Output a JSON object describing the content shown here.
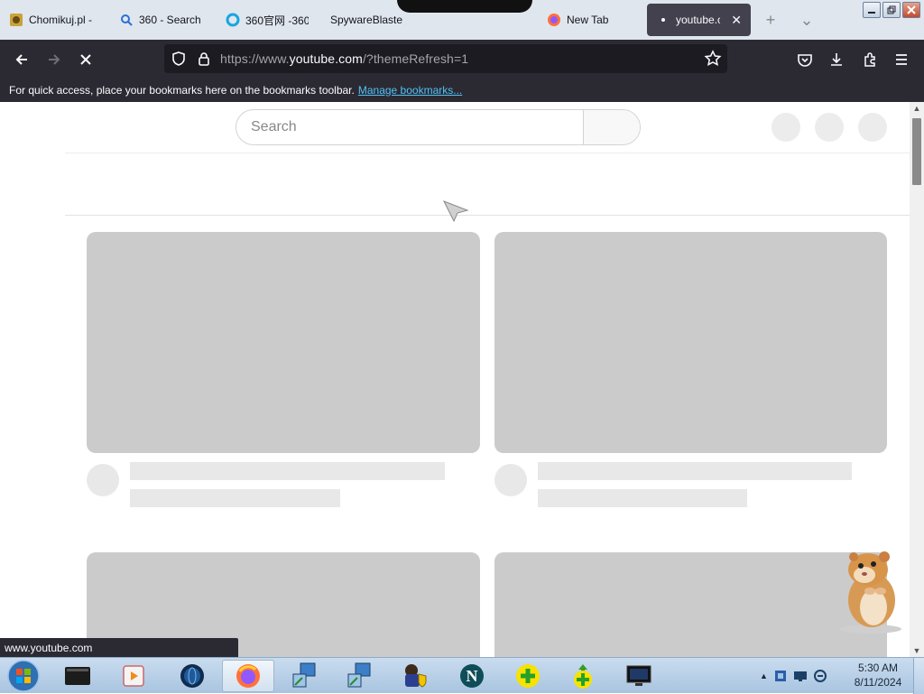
{
  "browser": {
    "tabs": [
      {
        "title": "Chomikuj.pl -",
        "icon": "chomikuj-icon"
      },
      {
        "title": "360 - Search",
        "icon": "search-icon"
      },
      {
        "title": "360官网 -360",
        "icon": "360-icon"
      },
      {
        "title": "SpywareBlaster",
        "icon": "generic-icon"
      },
      {
        "title": "",
        "icon": "generic-icon"
      },
      {
        "title": "New Tab",
        "icon": "firefox-icon"
      },
      {
        "title": "youtube.co",
        "icon": "loading-dot-icon",
        "active": true
      }
    ],
    "new_tab_label": "+",
    "list_tabs_label": "⌄",
    "url": {
      "prefix": "https://www.",
      "host": "youtube.com",
      "path": "/?themeRefresh=1"
    },
    "bookmarks_message": "For quick access, place your bookmarks here on the bookmarks toolbar.",
    "bookmarks_link": "Manage bookmarks...",
    "status_url": "www.youtube.com"
  },
  "youtube": {
    "search_placeholder": "Search"
  },
  "taskbar": {
    "apps": [
      {
        "name": "terminal-app-icon"
      },
      {
        "name": "media-player-icon"
      },
      {
        "name": "globe-app-icon"
      },
      {
        "name": "firefox-icon",
        "active": true
      },
      {
        "name": "network-installer-icon"
      },
      {
        "name": "network-installer-2-icon"
      },
      {
        "name": "shield-user-icon"
      },
      {
        "name": "netscape-icon"
      },
      {
        "name": "plus-green-icon"
      },
      {
        "name": "plus-green-arrow-icon"
      },
      {
        "name": "monitor-app-icon"
      }
    ],
    "clock_time": "5:30 AM",
    "clock_date": "8/11/2024"
  },
  "colors": {
    "toolbar": "#2b2a33",
    "urlbar": "#1c1b22",
    "link": "#52c1f7",
    "skeleton_thumb": "#cbcbcb",
    "skeleton_line": "#e8e8e8"
  }
}
